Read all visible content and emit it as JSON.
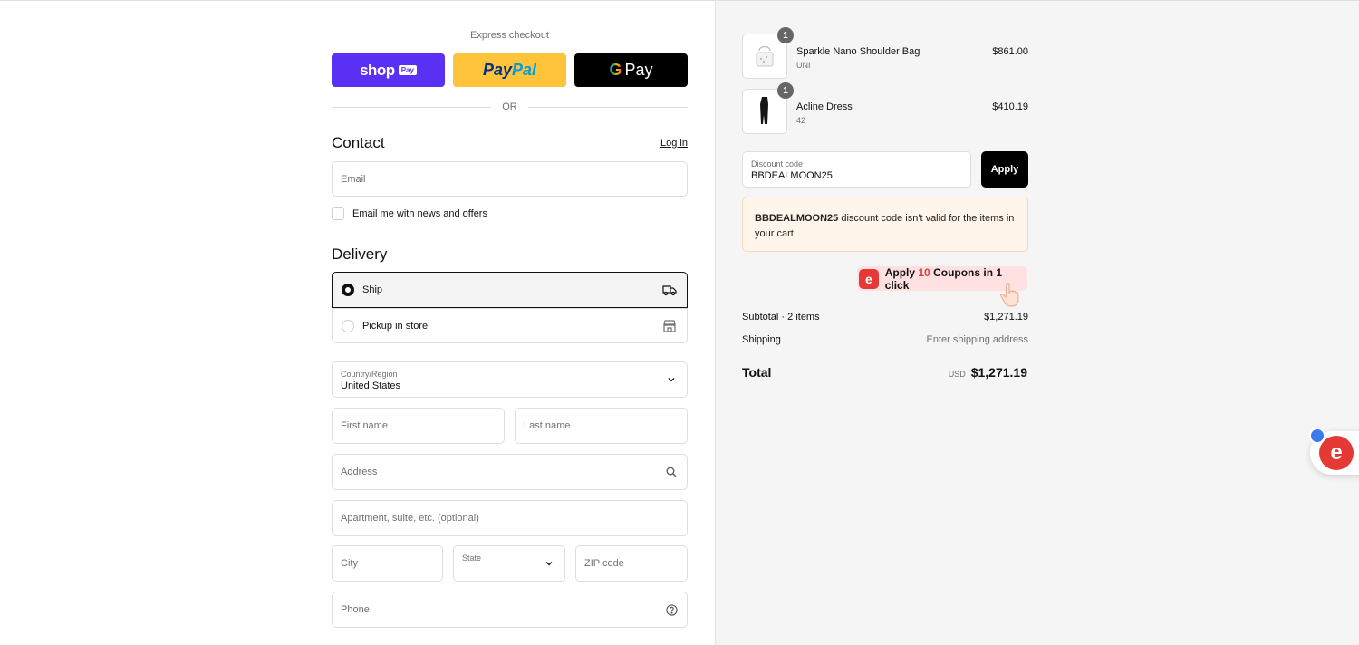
{
  "express": {
    "title": "Express checkout",
    "shop_word": "shop",
    "shop_pay": "Pay",
    "paypal_1": "Pay",
    "paypal_2": "Pal",
    "gpay_g": "G",
    "gpay_word": "Pay",
    "or": "OR"
  },
  "contact": {
    "heading": "Contact",
    "login": "Log in",
    "email_placeholder": "Email",
    "newsletter_label": "Email me with news and offers"
  },
  "delivery": {
    "heading": "Delivery",
    "options": [
      {
        "label": "Ship",
        "selected": true,
        "icon": "truck-icon"
      },
      {
        "label": "Pickup in store",
        "selected": false,
        "icon": "store-icon"
      }
    ],
    "country_label": "Country/Region",
    "country_value": "United States",
    "first_name": "First name",
    "last_name": "Last name",
    "address": "Address",
    "apartment": "Apartment, suite, etc. (optional)",
    "city": "City",
    "state_label": "State",
    "zip": "ZIP code",
    "phone": "Phone"
  },
  "cart": {
    "items": [
      {
        "name": "Sparkle Nano Shoulder Bag",
        "variant": "UNI",
        "price": "$861.00",
        "qty": "1"
      },
      {
        "name": "Acline Dress",
        "variant": "42",
        "price": "$410.19",
        "qty": "1"
      }
    ],
    "discount_label": "Discount code",
    "discount_value": "BBDEALMOON25",
    "apply": "Apply",
    "error_code": "BBDEALMOON25",
    "error_text": " discount code isn't valid for the items in your cart",
    "coupon": {
      "prefix": "Apply ",
      "count": "10",
      "suffix": " Coupons in 1 click",
      "logo": "e"
    },
    "subtotal_label": "Subtotal · 2 items",
    "subtotal_value": "$1,271.19",
    "shipping_label": "Shipping",
    "shipping_value": "Enter shipping address",
    "total_label": "Total",
    "currency": "USD",
    "total_value": "$1,271.19"
  },
  "widget": {
    "logo": "e"
  },
  "colors": {
    "shop": "#5a31f4",
    "paypal": "#ffc439",
    "accent_red": "#e53935",
    "error_bg": "#fff5ea"
  }
}
